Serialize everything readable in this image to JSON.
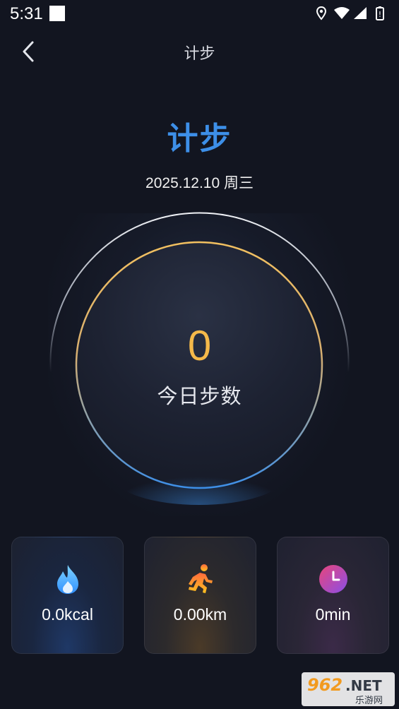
{
  "status_bar": {
    "time": "5:31"
  },
  "nav": {
    "title": "计步"
  },
  "heading": "计步",
  "date": "2025.12.10 周三",
  "dial": {
    "step_count": "0",
    "label": "今日步数",
    "colors": {
      "outer_ring": "#e9ecf2",
      "inner_ring_top": "#f2c060",
      "inner_ring_bottom": "#3d8fe8",
      "count": "#f5b94a"
    }
  },
  "stats": [
    {
      "icon": "flame-icon",
      "value": "0.0kcal",
      "color": "#4fb8ff"
    },
    {
      "icon": "runner-icon",
      "value": "0.00km",
      "color": "#ffab1f"
    },
    {
      "icon": "clock-icon",
      "value": "0min",
      "color": "#c14fe0"
    }
  ],
  "watermark": {
    "brand": "962.NET",
    "sub": "乐游网"
  },
  "colors": {
    "background": "#121520",
    "accent": "#3d8fe8"
  }
}
